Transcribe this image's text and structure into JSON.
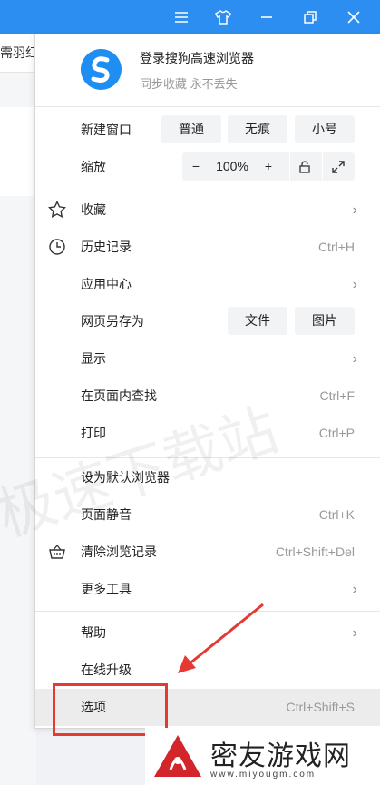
{
  "background": {
    "tab_text": "需羽红"
  },
  "account": {
    "title": "登录搜狗高速浏览器",
    "subtitle": "同步收藏 永不丢失"
  },
  "new_window": {
    "label": "新建窗口",
    "normal": "普通",
    "incognito": "无痕",
    "small": "小号"
  },
  "zoom": {
    "label": "缩放",
    "minus": "−",
    "value": "100%",
    "plus": "+"
  },
  "menu": {
    "favorites": "收藏",
    "history": {
      "label": "历史记录",
      "shortcut": "Ctrl+H"
    },
    "app_center": "应用中心",
    "save_as": {
      "label": "网页另存为",
      "file": "文件",
      "image": "图片"
    },
    "display": "显示",
    "find": {
      "label": "在页面内查找",
      "shortcut": "Ctrl+F"
    },
    "print": {
      "label": "打印",
      "shortcut": "Ctrl+P"
    },
    "set_default": "设为默认浏览器",
    "mute": {
      "label": "页面静音",
      "shortcut": "Ctrl+K"
    },
    "clear": {
      "label": "清除浏览记录",
      "shortcut": "Ctrl+Shift+Del"
    },
    "more_tools": "更多工具",
    "help": "帮助",
    "upgrade": "在线升级",
    "options": {
      "label": "选项",
      "shortcut": "Ctrl+Shift+S"
    }
  },
  "watermark": "极速下载站",
  "site_logo": {
    "text": "密友游戏网",
    "url": "www.miyougm.com"
  },
  "colors": {
    "titlebar": "#2b8ef0",
    "highlight": "#e53932",
    "logo_blue": "#1e8ef3"
  },
  "icons": [
    "menu-icon",
    "skin-icon",
    "minimize-icon",
    "restore-icon",
    "close-icon",
    "star-icon",
    "clock-icon",
    "basket-icon",
    "lock-icon",
    "fullscreen-icon",
    "chevron-right-icon"
  ]
}
